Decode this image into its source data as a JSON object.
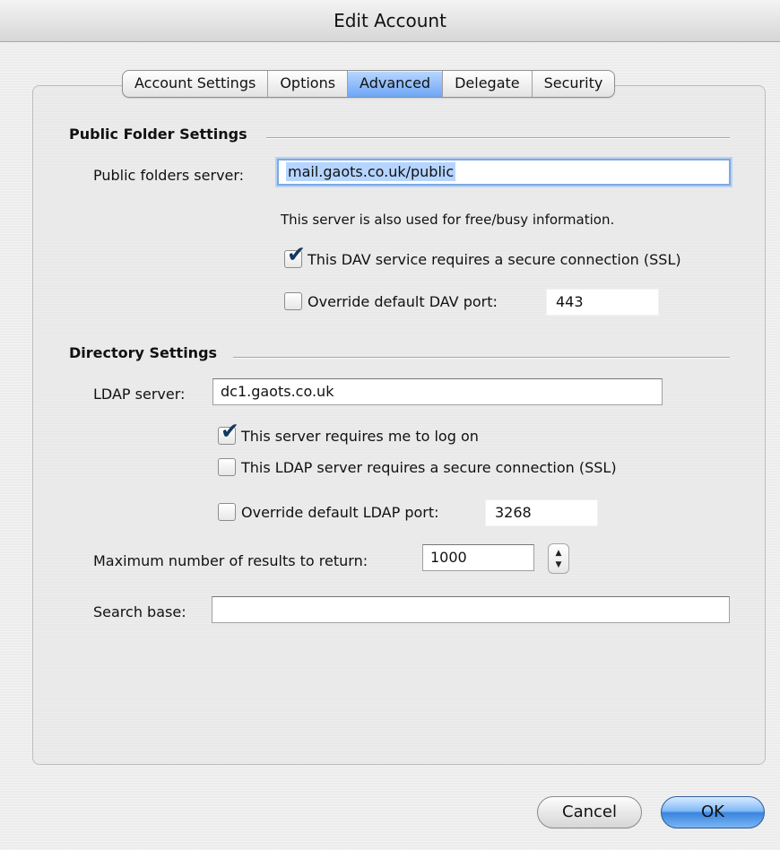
{
  "window": {
    "title": "Edit Account"
  },
  "tabs": [
    {
      "label": "Account Settings"
    },
    {
      "label": "Options"
    },
    {
      "label": "Advanced",
      "selected": true
    },
    {
      "label": "Delegate"
    },
    {
      "label": "Security"
    }
  ],
  "public_folder": {
    "heading": "Public Folder Settings",
    "server_label": "Public folders server:",
    "server_value": "mail.gaots.co.uk/public",
    "info_text": "This server is also used for free/busy information.",
    "ssl_label": "This DAV service requires a secure connection (SSL)",
    "ssl_checked": true,
    "override_label": "Override default DAV port:",
    "override_checked": false,
    "port_value": "443"
  },
  "directory": {
    "heading": "Directory Settings",
    "ldap_label": "LDAP server:",
    "ldap_value": "dc1.gaots.co.uk",
    "logon_label": "This server requires me to log on",
    "logon_checked": true,
    "ssl_label": "This LDAP server requires a secure connection (SSL)",
    "ssl_checked": false,
    "override_label": "Override default LDAP port:",
    "override_checked": false,
    "port_value": "3268",
    "max_results_label": "Maximum number of results to return:",
    "max_results_value": "1000",
    "search_base_label": "Search base:",
    "search_base_value": ""
  },
  "buttons": {
    "cancel": "Cancel",
    "ok": "OK"
  },
  "colors": {
    "accent": "#6ea6f5",
    "default_button": "#3b84de"
  }
}
